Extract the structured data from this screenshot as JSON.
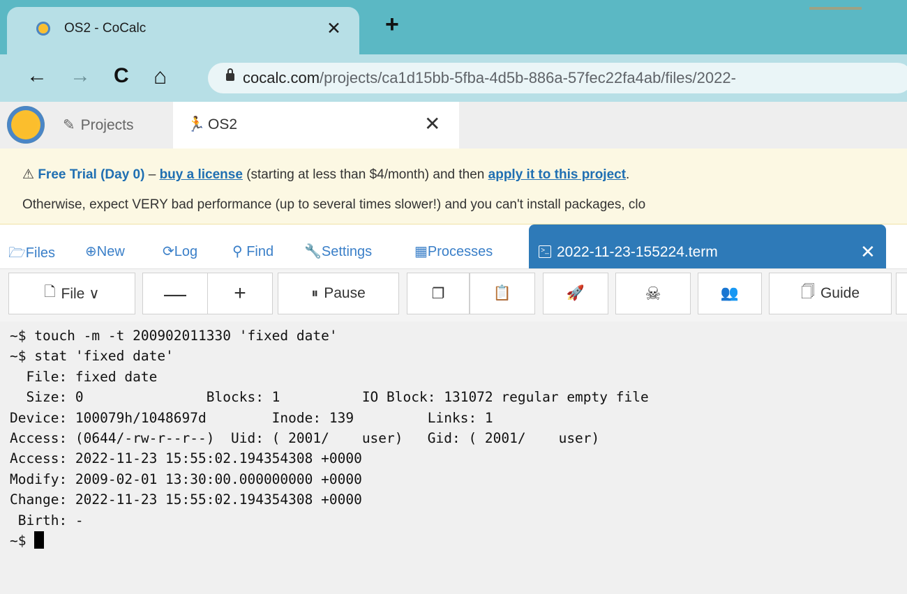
{
  "browser": {
    "tab_title": "OS2 - CoCalc",
    "tab_close": "✕",
    "new_tab": "+",
    "back": "←",
    "forward": "→",
    "reload": "C",
    "home": "⌂",
    "url_host": "cocalc.com",
    "url_path": "/projects/ca1d15bb-5fba-4d5b-886a-57fec22fa4ab/files/2022-"
  },
  "cocalc": {
    "projects_icon": "✎",
    "projects_label": "Projects",
    "project_tab_icon": "🏃",
    "project_tab_label": "OS2",
    "project_tab_close": "✕"
  },
  "banner": {
    "warning_icon": "⚠",
    "trial_label": "Free Trial (Day 0)",
    "dash": " – ",
    "buy_link": "buy a license",
    "mid_text": " (starting at less than $4/month) and then ",
    "apply_link": "apply it to this project",
    "end_text": ".",
    "line2": "Otherwise, expect VERY bad performance (up to several times slower!) and you can't install packages, clo"
  },
  "project_nav": {
    "files": "🗁Files",
    "new": "⊕New",
    "log": "⟳Log",
    "find": "⚲ Find",
    "settings": "🔧Settings",
    "processes": "▦Processes",
    "term_icon": ">_",
    "term_tab": "2022-11-23-155224.term",
    "term_close": "✕"
  },
  "term_toolbar": {
    "file_icon": "🗋",
    "file": "File ∨",
    "zoom_out": "—",
    "zoom_in": "+",
    "pause_icon": "⏸",
    "pause": "Pause",
    "copy_icon": "❐",
    "paste_icon": "📋",
    "kick_icon": "🚀",
    "kill_icon": "☠",
    "users_icon": "👥",
    "guide_icon": "🗍",
    "guide": "Guide"
  },
  "terminal": {
    "lines": [
      "~$ touch -m -t 200902011330 'fixed date'",
      "~$ stat 'fixed date'",
      "  File: fixed date",
      "  Size: 0               Blocks: 1          IO Block: 131072 regular empty file",
      "Device: 100079h/1048697d        Inode: 139         Links: 1",
      "Access: (0644/-rw-r--r--)  Uid: ( 2001/    user)   Gid: ( 2001/    user)",
      "Access: 2022-11-23 15:55:02.194354308 +0000",
      "Modify: 2009-02-01 13:30:00.000000000 +0000",
      "Change: 2022-11-23 15:55:02.194354308 +0000",
      " Birth: -"
    ],
    "prompt": "~$ "
  }
}
